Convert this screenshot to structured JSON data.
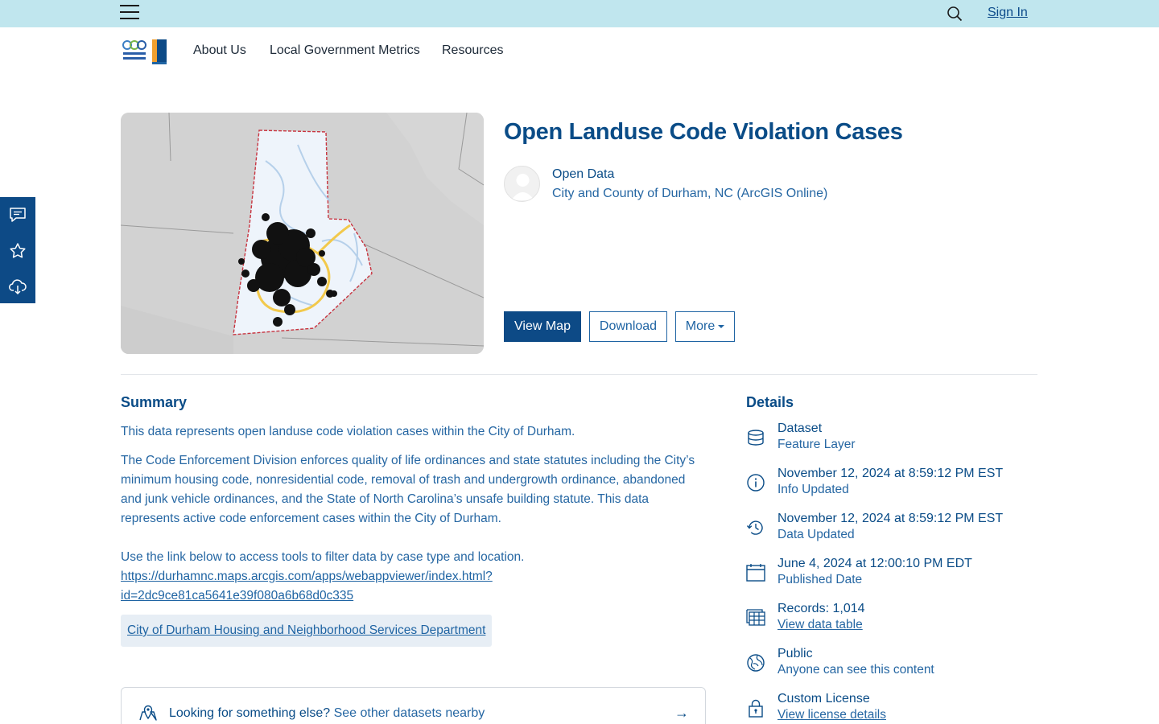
{
  "topbar": {
    "menu_icon": "hamburger-icon",
    "search_icon": "search-icon",
    "signin_label": "Sign In"
  },
  "nav": {
    "logo_icon": "durham-logo-icon",
    "items": [
      "About Us",
      "Local Government Metrics",
      "Resources"
    ]
  },
  "sidetools": {
    "icons": [
      "comment-icon",
      "star-icon",
      "cloud-download-icon"
    ]
  },
  "dataset": {
    "title": "Open Landuse Code Violation Cases",
    "owner": "Open Data",
    "org": "City and County of Durham, NC (ArcGIS Online)",
    "buttons": {
      "view_map": "View Map",
      "download": "Download",
      "more": "More"
    }
  },
  "summary": {
    "heading": "Summary",
    "p1": "This data represents open landuse code violation cases within the City of Durham.",
    "p2": "The Code Enforcement Division enforces quality of life ordinances and state statutes including the City’s minimum housing code, nonresidential code, removal of trash and undergrowth ordinance, abandoned and junk vehicle ordinances, and the State of North Carolina’s unsafe building statute. This data represents active code enforcement cases within the City of Durham.",
    "p3": "Use the link below to access tools to filter data by case type and location.",
    "url_line1": "https://durhamnc.maps.arcgis.com/apps/webappviewer/index.html?",
    "url_line2": "id=2dc9ce81ca5641e39f080a6b68d0c335",
    "dept_link": "City of Durham Housing and Neighborhood Services Department"
  },
  "nearby": {
    "icon": "map-pin-icon",
    "lead": "Looking for something else?",
    "rest": " See other datasets nearby",
    "arrow": "→"
  },
  "details": {
    "heading": "Details",
    "items": [
      {
        "icon": "database-icon",
        "main": "Dataset",
        "sub": "Feature Layer"
      },
      {
        "icon": "info-icon",
        "main": "November 12, 2024 at 8:59:12 PM EST",
        "sub": "Info Updated"
      },
      {
        "icon": "history-icon",
        "main": "November 12, 2024 at 8:59:12 PM EST",
        "sub": "Data Updated"
      },
      {
        "icon": "calendar-icon",
        "main": "June 4, 2024 at 12:00:10 PM EDT",
        "sub": "Published Date"
      },
      {
        "icon": "table-icon",
        "main": "Records: 1,014",
        "sub": "View data table"
      },
      {
        "icon": "globe-icon",
        "main": "Public",
        "sub": "Anyone can see this content"
      },
      {
        "icon": "lock-icon",
        "main": "Custom License",
        "sub": "View license details"
      }
    ]
  },
  "colors": {
    "topbar": "#c0e6ee",
    "brand": "#0d4a86",
    "link": "#1f64a3"
  }
}
